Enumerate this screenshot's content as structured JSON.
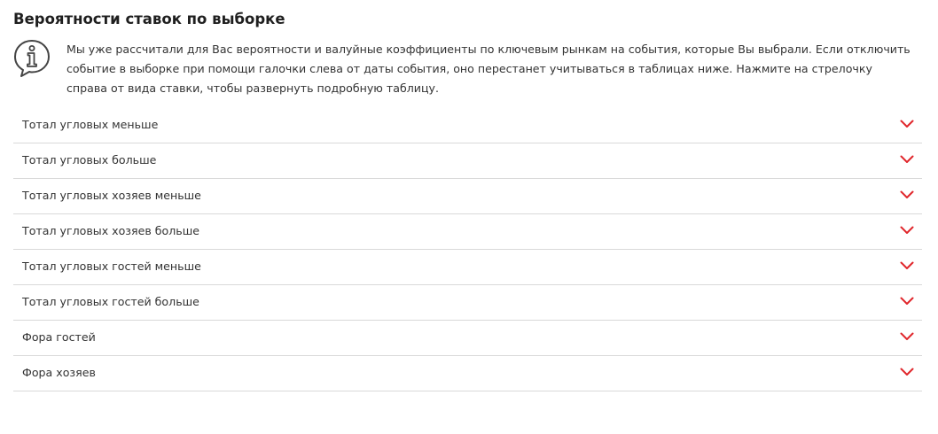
{
  "section": {
    "title": "Вероятности ставок по выборке",
    "info_text": "Мы уже рассчитали для Вас вероятности и валуйные коэффициенты по ключевым рынкам на события, которые Вы выбрали. Если отключить событие в выборке при помощи галочки слева от даты события, оно перестанет учитываться в таблицах ниже. Нажмите на стрелочку справа от вида ставки, чтобы развернуть подробную таблицу.",
    "info_icon": "info-speech-bubble-icon"
  },
  "accordion": {
    "expand_icon": "chevron-down-icon",
    "items": [
      {
        "label": "Тотал угловых меньше"
      },
      {
        "label": "Тотал угловых больше"
      },
      {
        "label": "Тотал угловых хозяев меньше"
      },
      {
        "label": "Тотал угловых хозяев больше"
      },
      {
        "label": "Тотал угловых гостей меньше"
      },
      {
        "label": "Тотал угловых гостей больше"
      },
      {
        "label": "Фора гостей"
      },
      {
        "label": "Фора хозяев"
      }
    ]
  },
  "colors": {
    "accent": "#e0262b",
    "divider": "#d9d9d9",
    "text": "#333333",
    "icon": "#444444"
  }
}
